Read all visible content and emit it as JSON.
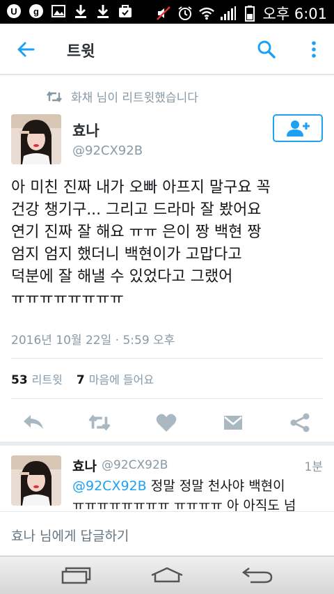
{
  "status_bar": {
    "time": "오후 6:01"
  },
  "app_bar": {
    "title": "트윗"
  },
  "retweet_notice": "화채 님이 리트윗했습니다",
  "tweet": {
    "author_name": "효나",
    "author_handle": "@92CX92B",
    "text": "아 미친 진짜 내가 오빠 아프지 말구요 꼭\n건강 챙기구... 그리고 드라마 잘 봤어요\n연기 진짜 잘 해요 ㅠㅠ 은이 짱 백현 짱\n엄지 엄지 했더니 백현이가 고맙다고\n덕분에 잘 해낼 수 있었다고 그랬어\nㅠㅠㅠㅠㅠㅠㅠㅠ",
    "timestamp": "2016년 10월 22일 · 5:59 오후",
    "retweet_count": "53",
    "retweet_label": "리트윗",
    "like_count": "7",
    "like_label": "마음에 들어요"
  },
  "reply": {
    "author_name": "효나",
    "author_handle": "@92CX92B",
    "time_ago": "1분",
    "mention": "@92CX92B",
    "text_line1": " 정말 정말 천사야 백현이",
    "text_line2": "ㅠㅠㅠㅠㅠㅠㅠㅠ ㅠㅠㅠㅠ 아 아직도 넘"
  },
  "reply_bar": {
    "placeholder": "효나 님에게 답글하기"
  },
  "colors": {
    "accent": "#1da1f2",
    "muted": "#8899a6",
    "action_icon": "#aab8c2"
  }
}
